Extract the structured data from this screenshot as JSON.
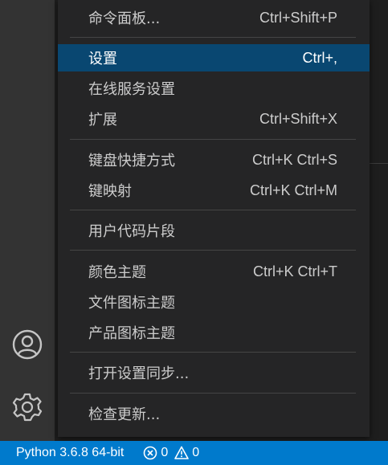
{
  "menu": {
    "items": [
      {
        "label": "命令面板...",
        "shortcut": "Ctrl+Shift+P",
        "selected": false
      },
      {
        "label": "设置",
        "shortcut": "Ctrl+,",
        "selected": true
      },
      {
        "label": "在线服务设置",
        "shortcut": "",
        "selected": false
      },
      {
        "label": "扩展",
        "shortcut": "Ctrl+Shift+X",
        "selected": false
      },
      {
        "label": "键盘快捷方式",
        "shortcut": "Ctrl+K Ctrl+S",
        "selected": false
      },
      {
        "label": "键映射",
        "shortcut": "Ctrl+K Ctrl+M",
        "selected": false
      },
      {
        "label": "用户代码片段",
        "shortcut": "",
        "selected": false
      },
      {
        "label": "颜色主题",
        "shortcut": "Ctrl+K Ctrl+T",
        "selected": false
      },
      {
        "label": "文件图标主题",
        "shortcut": "",
        "selected": false
      },
      {
        "label": "产品图标主题",
        "shortcut": "",
        "selected": false
      },
      {
        "label": "打开设置同步...",
        "shortcut": "",
        "selected": false
      },
      {
        "label": "检查更新...",
        "shortcut": "",
        "selected": false
      }
    ]
  },
  "activity_bar": {
    "icons": [
      "account-icon",
      "manage-gear-icon"
    ]
  },
  "status_bar": {
    "python": "Python 3.6.8 64-bit",
    "errors": "0",
    "warnings": "0"
  },
  "colors": {
    "activity_bar": "#333333",
    "menu_background": "#252526",
    "menu_selected": "#094771",
    "status_bar": "#007acc",
    "menu_text": "#cccccc"
  }
}
